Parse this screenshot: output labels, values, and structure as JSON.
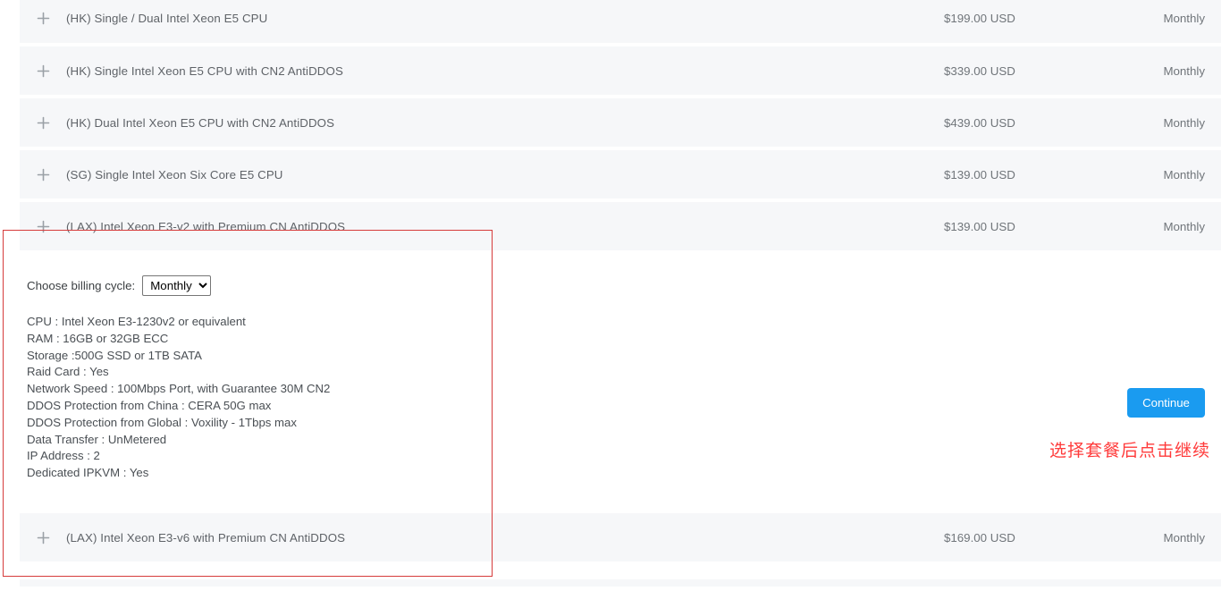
{
  "products": [
    {
      "name": "(HK) Single / Dual Intel Xeon E5 CPU",
      "price": "$199.00 USD",
      "cycle": "Monthly",
      "toggle": "plus-icon"
    },
    {
      "name": "(HK) Single Intel Xeon E5 CPU with CN2 AntiDDOS",
      "price": "$339.00 USD",
      "cycle": "Monthly",
      "toggle": "plus-icon"
    },
    {
      "name": "(HK) Dual Intel Xeon E5 CPU with CN2 AntiDDOS",
      "price": "$439.00 USD",
      "cycle": "Monthly",
      "toggle": "plus-icon"
    },
    {
      "name": "(SG) Single Intel Xeon Six Core E5 CPU",
      "price": "$139.00 USD",
      "cycle": "Monthly",
      "toggle": "plus-icon"
    },
    {
      "name": "(LAX) Intel Xeon E3-v2 with Premium CN AntiDDOS",
      "price": "$139.00 USD",
      "cycle": "Monthly",
      "toggle": "plus-icon"
    },
    {
      "name": "(LAX) Intel Xeon E3-v6 with Premium CN AntiDDOS",
      "price": "$169.00 USD",
      "cycle": "Monthly",
      "toggle": "plus-icon"
    }
  ],
  "detail": {
    "billing_label": "Choose billing cycle:",
    "billing_selected": "Monthly",
    "billing_options": [
      "Monthly"
    ],
    "specs": [
      "CPU  : Intel Xeon E3-1230v2 or equivalent",
      "RAM : 16GB or 32GB ECC",
      "Storage :500G SSD or 1TB SATA",
      "Raid Card : Yes",
      "Network Speed : 100Mbps Port, with Guarantee 30M CN2",
      "DDOS Protection from China : CERA 50G max",
      "DDOS Protection from Global : Voxility - 1Tbps max",
      "Data Transfer : UnMetered",
      "IP Address : 2",
      "Dedicated IPKVM : Yes"
    ]
  },
  "actions": {
    "continue_label": "Continue",
    "annotation": "选择套餐后点击继续",
    "annotation_color": "#ff3b3b",
    "continue_color": "#1a9bf0",
    "highlight_color": "#d63b3b"
  }
}
